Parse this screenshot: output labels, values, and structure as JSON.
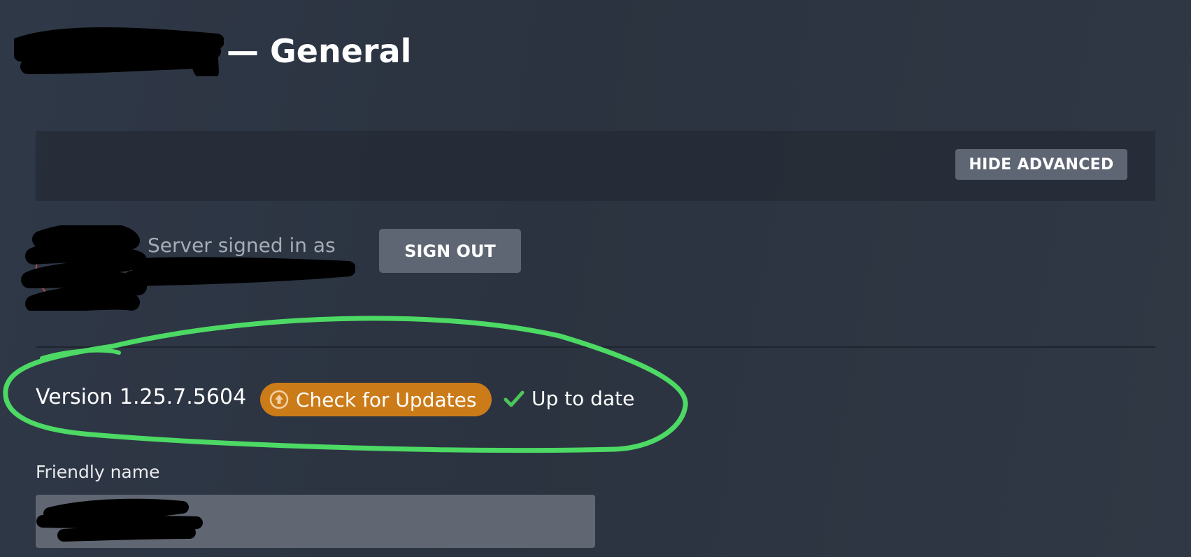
{
  "header": {
    "title": "— General"
  },
  "advanced": {
    "hide_label": "HIDE ADVANCED"
  },
  "account": {
    "signed_in_label": "Server signed in as",
    "sign_out_label": "SIGN OUT"
  },
  "version": {
    "text": "Version 1.25.7.5604",
    "check_updates_label": "Check for Updates",
    "status": "Up to date"
  },
  "friendly_name": {
    "label": "Friendly name",
    "value": ""
  },
  "icons": {
    "update": "upload-circle-icon",
    "status": "checkmark-icon"
  },
  "colors": {
    "background": "#2d3542",
    "button_gray": "#5f6673",
    "update_orange": "#cc7b19",
    "check_green": "#4cc65a",
    "highlight_green": "#4cd964",
    "input_bg": "#606772"
  }
}
